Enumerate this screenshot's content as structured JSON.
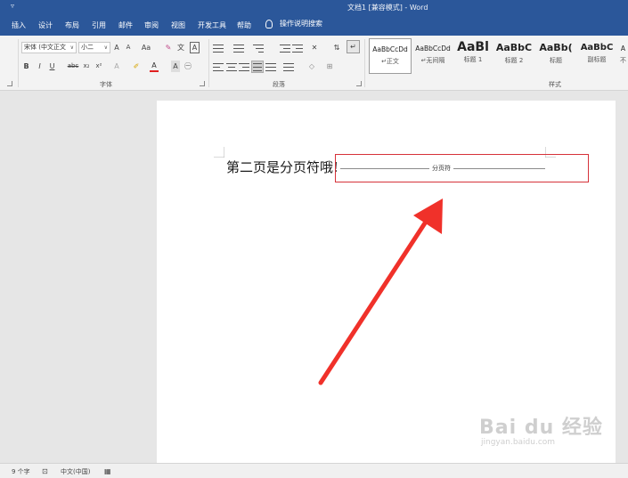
{
  "window": {
    "title": "文档1 [兼容模式] - Word",
    "qat_icon": "▿"
  },
  "tabs": [
    "插入",
    "设计",
    "布局",
    "引用",
    "邮件",
    "审阅",
    "视图",
    "开发工具",
    "帮助"
  ],
  "tell_me": "操作说明搜索",
  "font_group": {
    "font_name": "宋体 (中文正文",
    "font_size": "小二",
    "grow": "A",
    "shrink": "A",
    "case": "Aa",
    "bold": "B",
    "italic": "I",
    "underline": "U",
    "strike": "abc",
    "subscript": "x₂",
    "superscript": "x²",
    "label": "字体"
  },
  "paragraph_group": {
    "label": "段落"
  },
  "styles_group": {
    "label": "样式",
    "items": [
      {
        "preview": "AaBbCcDd",
        "name": "↵正文"
      },
      {
        "preview": "AaBbCcDd",
        "name": "↵无间隔"
      },
      {
        "preview": "AaBl",
        "name": "标题 1"
      },
      {
        "preview": "AaBbC",
        "name": "标题 2"
      },
      {
        "preview": "AaBb(",
        "name": "标题"
      },
      {
        "preview": "AaBbC",
        "name": "副标题"
      },
      {
        "preview": "A",
        "name": "不"
      }
    ]
  },
  "document": {
    "text": "第二页是分页符哦!",
    "page_break_label": "分页符"
  },
  "status": {
    "page": "9 个字",
    "language": "中文(中国)"
  },
  "watermark": {
    "brand": "Bai du 经验",
    "url": "jingyan.baidu.com"
  },
  "colors": {
    "accent": "#2b579a",
    "highlight_box": "#d6323a",
    "arrow": "#f0312a"
  }
}
